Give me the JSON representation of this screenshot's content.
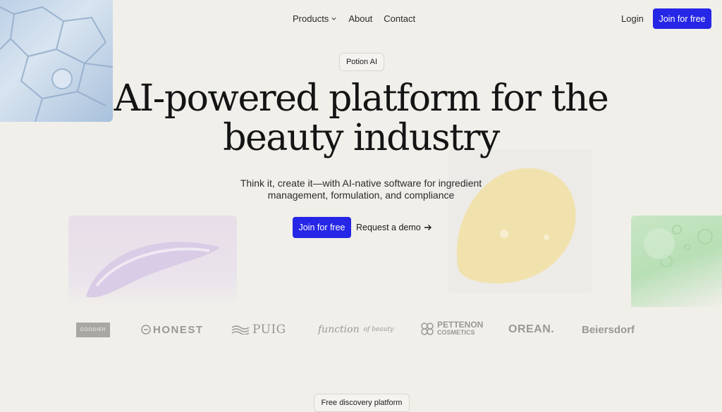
{
  "nav": {
    "items": [
      "Products",
      "About",
      "Contact"
    ],
    "login": "Login",
    "join": "Join for free"
  },
  "hero": {
    "badge": "Potion AI",
    "headline_line1": "AI-powered platform for the",
    "headline_line2": "beauty industry",
    "subtitle_line1": "Think it, create it—with AI-native software for ingredient",
    "subtitle_line2": "management, formulation, and compliance",
    "cta_primary": "Join for free",
    "cta_secondary": "Request a demo"
  },
  "logos": {
    "goodier": "GOODIER",
    "honest": "HONEST",
    "puig": "PUIG",
    "function": "function",
    "function_suffix": "of beauty",
    "pettenon_1": "PETTENON",
    "pettenon_2": "COSMETICS",
    "orean": "OREAN.",
    "beiersdorf": "Beiersdorf"
  },
  "section": {
    "badge": "Free discovery platform"
  },
  "colors": {
    "accent": "#2626e6",
    "background": "#f1efea"
  }
}
